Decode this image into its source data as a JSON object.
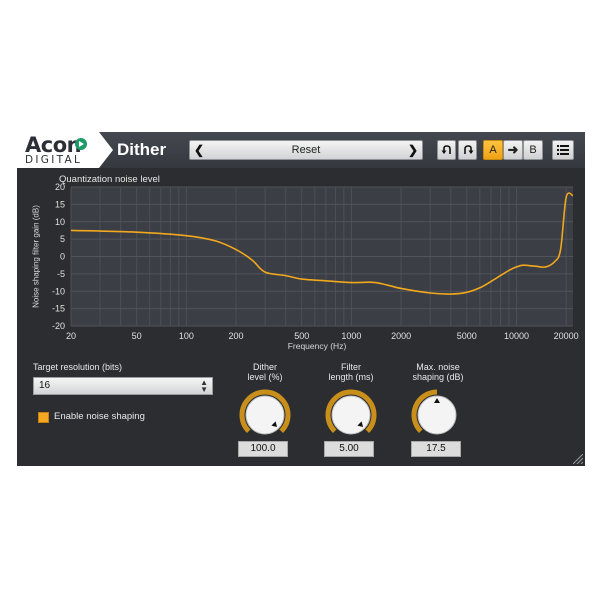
{
  "brand": {
    "line1": "Acon",
    "line2": "DIGITAL"
  },
  "plugin_name": "Dither",
  "preset": {
    "name": "Reset",
    "prev_icon": "chevron-left-icon",
    "next_icon": "chevron-right-icon"
  },
  "toolbar": {
    "undo_icon": "undo-icon",
    "redo_icon": "redo-icon",
    "a_label": "A",
    "copy_icon": "arrow-right-icon",
    "b_label": "B",
    "menu_icon": "menu-icon"
  },
  "graph": {
    "title": "Quantization noise level",
    "ylabel": "Noise shaping filter gain (dB)",
    "xlabel": "Frequency (Hz)",
    "y_ticks": [
      "20",
      "15",
      "10",
      "5",
      "0",
      "-5",
      "-10",
      "-15",
      "-20"
    ],
    "x_ticks": [
      "20",
      "50",
      "100",
      "200",
      "500",
      "1000",
      "2000",
      "5000",
      "10000",
      "20000"
    ]
  },
  "chart_data": {
    "type": "line",
    "title": "Quantization noise level",
    "xlabel": "Frequency (Hz)",
    "ylabel": "Noise shaping filter gain (dB)",
    "xscale": "log",
    "xlim": [
      20,
      22000
    ],
    "ylim": [
      -20,
      20
    ],
    "grid": true,
    "series": [
      {
        "x": [
          20,
          50,
          100,
          150,
          200,
          250,
          300,
          400,
          500,
          700,
          1000,
          1400,
          2000,
          3000,
          4000,
          5000,
          6000,
          7000,
          8000,
          9000,
          10000,
          11000,
          13000,
          15000,
          17000,
          18500,
          20000,
          22000
        ],
        "y": [
          7.5,
          7,
          6,
          4.5,
          2,
          -1,
          -4.5,
          -5.5,
          -6.5,
          -7,
          -7.5,
          -7.5,
          -9.2,
          -10.5,
          -10.8,
          -10.3,
          -9,
          -7.2,
          -5.5,
          -4,
          -3,
          -2.5,
          -2.8,
          -3,
          -1.5,
          2,
          17,
          17.5
        ]
      }
    ]
  },
  "controls": {
    "target_resolution": {
      "label": "Target resolution (bits)",
      "value": "16"
    },
    "enable_noise_shaping": {
      "label": "Enable noise shaping",
      "checked": true
    },
    "knobs": [
      {
        "label_line1": "Dither",
        "label_line2": "level (%)",
        "value": "100.0",
        "fraction": 1.0
      },
      {
        "label_line1": "Filter",
        "label_line2": "length (ms)",
        "value": "5.00",
        "fraction": 1.0
      },
      {
        "label_line1": "Max. noise",
        "label_line2": "shaping (dB)",
        "value": "17.5",
        "fraction": 0.5
      }
    ]
  },
  "colors": {
    "accent": "#f5a623",
    "panel": "#2b2d31",
    "plot_bg": "#3b3e44",
    "curve": "#f2a81d"
  }
}
